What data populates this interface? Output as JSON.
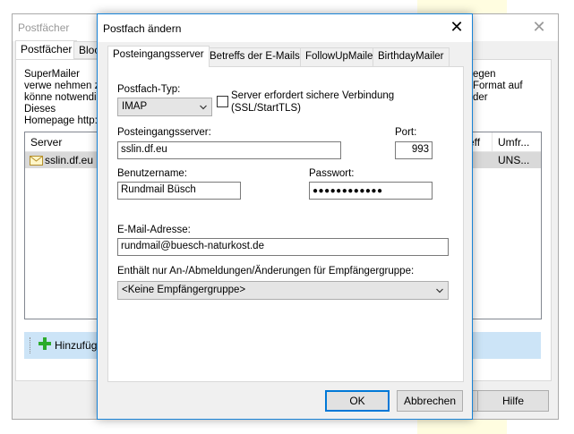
{
  "background_window": {
    "title": "Postfächer",
    "tabs": [
      "Postfächer",
      "Block"
    ],
    "intro_text_left": "SuperMailer verwe nehmen zu könne notwendig. Dieses Homepage http:/",
    "intro_text_right": "egen Format auf der",
    "list_columns": [
      "Server",
      "eff",
      "Umfr..."
    ],
    "list_rows": [
      {
        "server": "sslin.df.eu",
        "umfr": "UNS..."
      }
    ],
    "add_button_label": "Hinzufüge",
    "help_button_label": "Hilfe"
  },
  "dialog": {
    "title": "Postfach ändern",
    "tabs": [
      "Posteingangsserver",
      "Betreffs der E-Mails",
      "FollowUpMailer",
      "BirthdayMailer"
    ],
    "mailbox_type_label": "Postfach-Typ:",
    "mailbox_type_value": "IMAP",
    "secure_checkbox_label_line1": "Server erfordert sichere Verbindung",
    "secure_checkbox_label_line2": "(SSL/StartTLS)",
    "secure_checked": false,
    "incoming_server_label": "Posteingangsserver:",
    "incoming_server_value": "sslin.df.eu",
    "port_label": "Port:",
    "port_value": "993",
    "username_label": "Benutzername:",
    "username_value": "Rundmail Büsch",
    "password_label": "Passwort:",
    "password_value": "●●●●●●●●●●●●",
    "email_label": "E-Mail-Adresse:",
    "email_value": "rundmail@buesch-naturkost.de",
    "group_label": "Enthält nur An-/Abmeldungen/Änderungen für Empfängergruppe:",
    "group_value": "<Keine Empfängergruppe>",
    "ok_label": "OK",
    "cancel_label": "Abbrechen"
  },
  "colors": {
    "accent": "#0078d7",
    "dialog_border": "#1883d7",
    "selection_row": "#d9d9d9",
    "add_bar": "#cce4f7",
    "plus_icon": "#2bab2b"
  }
}
